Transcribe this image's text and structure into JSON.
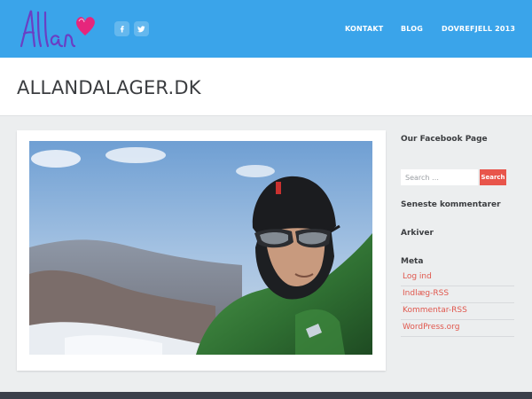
{
  "header": {
    "logo_text": "Allan",
    "social": [
      "facebook-icon",
      "twitter-icon"
    ],
    "nav": [
      {
        "label": "KONTAKT"
      },
      {
        "label": "BLOG"
      },
      {
        "label": "DOVREFJELL 2013"
      }
    ]
  },
  "site": {
    "title": "ALLANDALAGER.DK"
  },
  "sidebar": {
    "facebook_title": "Our Facebook Page",
    "search": {
      "placeholder": "Search …",
      "button_label": "Search"
    },
    "recent_comments_title": "Seneste kommentarer",
    "archives_title": "Arkiver",
    "meta_title": "Meta",
    "meta_links": [
      "Log ind",
      "Indlæg-RSS",
      "Kommentar-RSS",
      "WordPress.org"
    ]
  },
  "colors": {
    "header_bg": "#3aa4ea",
    "accent": "#e8554b",
    "link": "#e0574d",
    "footer_bg": "#3b3f4a"
  }
}
